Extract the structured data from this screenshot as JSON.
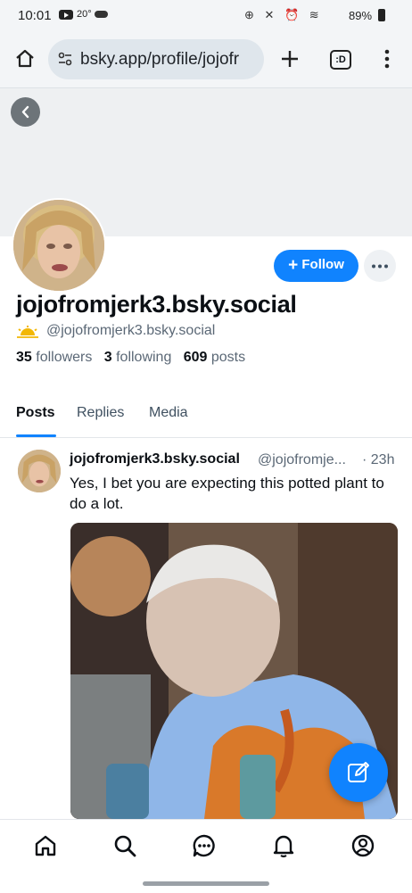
{
  "status_bar": {
    "time": "10:01",
    "temperature": "20°",
    "battery": "89%"
  },
  "browser": {
    "url": "bsky.app/profile/jojofr",
    "tab_count": ":D",
    "icons": [
      "home-icon",
      "site-settings-icon",
      "new-tab-icon",
      "tab-switcher-icon",
      "more-vert-icon"
    ]
  },
  "profile": {
    "display_name": "jojofromjerk3.bsky.social",
    "handle": "@jojofromjerk3.bsky.social",
    "follow_label": "Follow",
    "stats": {
      "followers_count": "35",
      "followers_label": "followers",
      "following_count": "3",
      "following_label": "following",
      "posts_count": "609",
      "posts_label": "posts"
    }
  },
  "tabs": [
    {
      "label": "Posts",
      "active": true
    },
    {
      "label": "Replies",
      "active": false
    },
    {
      "label": "Media",
      "active": false
    }
  ],
  "post": {
    "author_name": "jojofromjerk3.bsky.social",
    "author_handle": "@jojofromje...",
    "time": "· 23h",
    "text": "Yes, I bet you are expecting this potted plant to do a lot."
  },
  "bottom_nav": [
    "home-icon",
    "search-icon",
    "chat-icon",
    "bell-icon",
    "profile-icon"
  ],
  "colors": {
    "accent": "#1083fe",
    "muted_text": "#5b6876",
    "banner": "#eef0f2"
  }
}
